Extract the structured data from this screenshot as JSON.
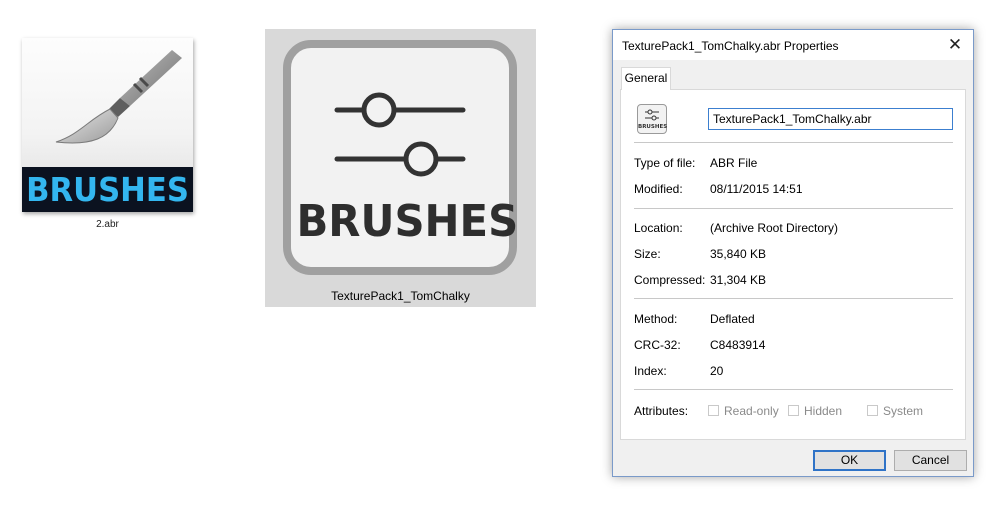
{
  "icon1": {
    "banner_text": "BRUSHES",
    "caption": "2.abr",
    "banner_color": "#33b6ef"
  },
  "icon2": {
    "text": "BRUSHES",
    "caption": "TexturePack1_TomChalky"
  },
  "dialog": {
    "title": "TexturePack1_TomChalky.abr Properties",
    "close_glyph": "✕",
    "tab": "General",
    "file_icon_text": "BRUSHES",
    "filename": "TexturePack1_TomChalky.abr",
    "props": {
      "type_label": "Type of file:",
      "type_value": "ABR File",
      "modified_label": "Modified:",
      "modified_value": "08/11/2015 14:51",
      "location_label": "Location:",
      "location_value": "(Archive Root Directory)",
      "size_label": "Size:",
      "size_value": "35,840 KB",
      "compressed_label": "Compressed:",
      "compressed_value": "31,304 KB",
      "method_label": "Method:",
      "method_value": "Deflated",
      "crc_label": "CRC-32:",
      "crc_value": "C8483914",
      "index_label": "Index:",
      "index_value": "20"
    },
    "attributes_label": "Attributes:",
    "attributes": [
      {
        "label": "Read-only",
        "checked": false
      },
      {
        "label": "Hidden",
        "checked": false
      },
      {
        "label": "System",
        "checked": false
      }
    ],
    "ok_label": "OK",
    "cancel_label": "Cancel"
  }
}
